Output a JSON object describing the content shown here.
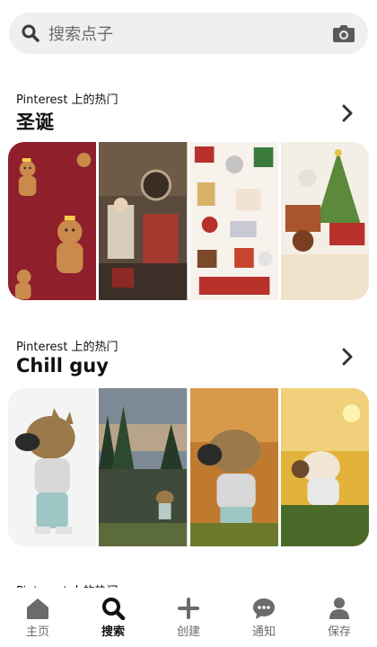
{
  "search": {
    "placeholder": "搜索点子"
  },
  "sections": [
    {
      "subtitle": "Pinterest 上的热门",
      "title": "圣诞"
    },
    {
      "subtitle": "Pinterest 上的热门",
      "title": "Chill guy"
    },
    {
      "subtitle": "Pinterest 上的热门"
    }
  ],
  "tabs": [
    {
      "label": "主页",
      "icon": "home-icon"
    },
    {
      "label": "搜索",
      "icon": "search-icon",
      "active": true
    },
    {
      "label": "创建",
      "icon": "plus-icon"
    },
    {
      "label": "通知",
      "icon": "chat-bubble-icon"
    },
    {
      "label": "保存",
      "icon": "person-icon"
    }
  ]
}
